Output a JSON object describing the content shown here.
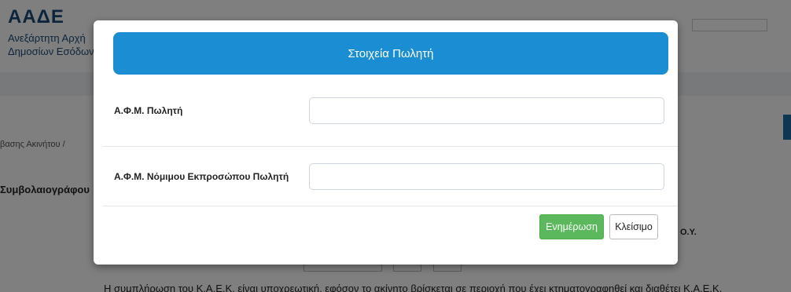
{
  "background": {
    "logo": "ΑΑΔΕ",
    "org_line1": "Ανεξάρτητη Αρχή",
    "org_line2": "Δημοσίων Εσόδων",
    "user_role": "Συμβολαιογράφος",
    "breadcrumb": "βασης Ακινήτου  /",
    "section_title": "Συμβολαιογράφου",
    "oy_label": "Ο.Υ.",
    "note": "Η συμπλήρωση του Κ.Α.Ε.Κ. είναι υποχρεωτική, εφόσον το ακίνητο βρίσκεται σε περιοχή που έχει κτηματογραφηθεί και διαθέτει Κ.Α.Ε.Κ."
  },
  "modal": {
    "title": "Στοιχεία Πωλητή",
    "fields": [
      {
        "label": "Α.Φ.Μ. Πωλητή",
        "value": ""
      },
      {
        "label": "Α.Φ.Μ. Νόμιμου Εκπροσώπου Πωλητή",
        "value": ""
      }
    ],
    "buttons": {
      "update": "Ενημέρωση",
      "close": "Κλείσιμο"
    }
  },
  "colors": {
    "header": "#1b8ed3",
    "update_button": "#5cb85c",
    "backdrop": "rgba(0,0,0,0.5)"
  }
}
